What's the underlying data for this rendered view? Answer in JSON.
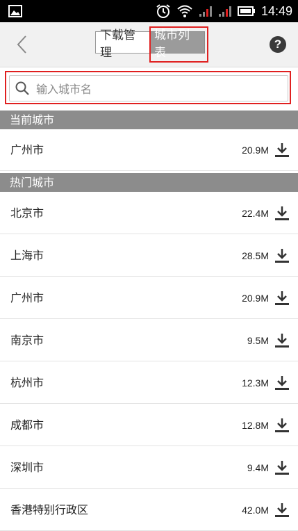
{
  "status_bar": {
    "time": "14:49"
  },
  "nav": {
    "tab_download": "下载管理",
    "tab_citylist": "城市列表",
    "help": "?"
  },
  "search": {
    "placeholder": "输入城市名"
  },
  "current_section": {
    "title": "当前城市",
    "items": [
      {
        "name": "广州市",
        "size": "20.9M"
      }
    ]
  },
  "hot_section": {
    "title": "热门城市",
    "items": [
      {
        "name": "北京市",
        "size": "22.4M"
      },
      {
        "name": "上海市",
        "size": "28.5M"
      },
      {
        "name": "广州市",
        "size": "20.9M"
      },
      {
        "name": "南京市",
        "size": "9.5M"
      },
      {
        "name": "杭州市",
        "size": "12.3M"
      },
      {
        "name": "成都市",
        "size": "12.8M"
      },
      {
        "name": "深圳市",
        "size": "9.4M"
      },
      {
        "name": "香港特别行政区",
        "size": "42.0M"
      }
    ]
  },
  "icons": {
    "status_left": "image-icon",
    "status_right": [
      "alarm-icon",
      "wifi-icon",
      "signal-icon",
      "signal-icon",
      "battery-icon"
    ],
    "back": "chevron-left-icon",
    "help": "help-icon",
    "search": "search-icon",
    "download": "download-icon"
  }
}
